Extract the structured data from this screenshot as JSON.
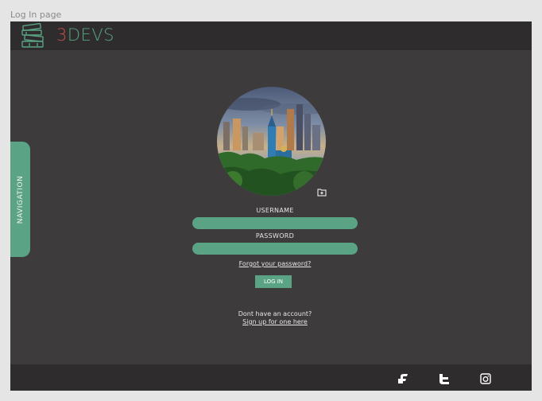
{
  "frame": {
    "label": "Log In page"
  },
  "header": {
    "logo_icon": "stacked-books-icon",
    "brand_accent": "3",
    "brand_rest": "DEVS"
  },
  "navigation": {
    "label": "NAVIGATION"
  },
  "login": {
    "avatar_icon": "city-photo",
    "upload_icon": "folder-plus-icon",
    "username_label": "USERNAME",
    "username_value": "",
    "password_label": "PASSWORD",
    "password_value": "",
    "forgot_link": "Forgot your password?",
    "login_button": "LOG IN",
    "no_account_text": "Dont have an account?",
    "signup_link": "Sign up for one here"
  },
  "footer": {
    "social_icons": [
      "facebook-icon",
      "twitter-icon",
      "instagram-icon"
    ]
  },
  "colors": {
    "accent_green": "#5aa384",
    "accent_red": "#c0504d",
    "background": "#3d3b3c",
    "bars": "#2e2c2d"
  }
}
